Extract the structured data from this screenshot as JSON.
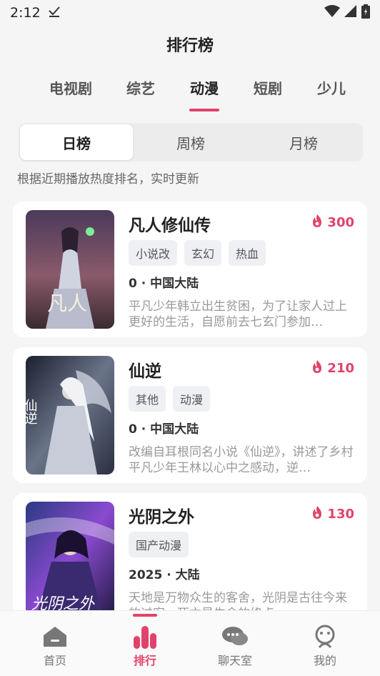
{
  "status_bar": {
    "time": "2:12"
  },
  "header": {
    "title": "排行榜"
  },
  "categories": [
    {
      "label": "电视剧"
    },
    {
      "label": "综艺"
    },
    {
      "label": "动漫",
      "active": true
    },
    {
      "label": "短剧"
    },
    {
      "label": "少儿"
    }
  ],
  "periods": [
    {
      "label": "日榜",
      "active": true
    },
    {
      "label": "周榜"
    },
    {
      "label": "月榜"
    }
  ],
  "hint": "根据近期播放热度排名，实时更新",
  "items": [
    {
      "title": "凡人修仙传",
      "heat": "300",
      "tags": [
        "小说改",
        "玄幻",
        "热血"
      ],
      "meta": "0 · 中国大陆",
      "desc": "平凡少年韩立出生贫困，为了让家人过上更好的生活，自愿前去七玄门参加…",
      "poster_title": "凡人"
    },
    {
      "title": "仙逆",
      "heat": "210",
      "tags": [
        "其他",
        "动漫"
      ],
      "meta": "0 · 中国大陆",
      "desc": "改编自耳根同名小说《仙逆》，讲述了乡村平凡少年王林以心中之感动，逆…",
      "poster_title": "仙逆"
    },
    {
      "title": "光阴之外",
      "heat": "130",
      "tags": [
        "国产动漫"
      ],
      "meta": "2025 · 大陆",
      "desc": "天地是万物众生的客舍，光阴是古往今来的过客。死亡是生命的终点…",
      "poster_title": "光阴之外"
    }
  ],
  "nav": [
    {
      "label": "首页",
      "icon": "home-icon"
    },
    {
      "label": "排行",
      "icon": "ranking-icon",
      "active": true
    },
    {
      "label": "聊天室",
      "icon": "chat-icon"
    },
    {
      "label": "我的",
      "icon": "profile-icon"
    }
  ],
  "colors": {
    "accent": "#e0436a",
    "background": "#f5f5f5"
  }
}
